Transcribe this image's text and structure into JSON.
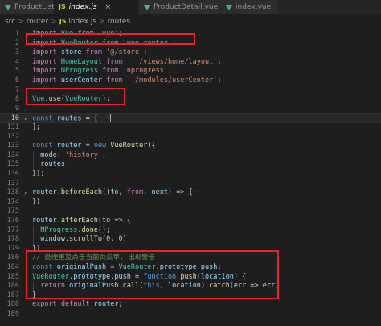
{
  "tabs": [
    {
      "label": "ProductList.vue",
      "icon": "vue-icon",
      "active": false
    },
    {
      "label": "index.js",
      "icon": "js-icon",
      "active": true,
      "close": "×"
    },
    {
      "label": "ProductDetail.vue",
      "icon": "vue-icon",
      "active": false
    },
    {
      "label": "index.vue",
      "icon": "vue-icon",
      "active": false
    }
  ],
  "js_icon_text": "JS",
  "breadcrumb": {
    "parts": [
      "src",
      "router",
      "index.js",
      "routes"
    ],
    "separator": ">",
    "file_icon_text": "JS"
  },
  "lines": [
    {
      "no": "1",
      "text": "import Vue from 'vue';"
    },
    {
      "no": "2",
      "text": "import VueRouter from 'vue-router';"
    },
    {
      "no": "3",
      "text": "import store from '@/store';"
    },
    {
      "no": "4",
      "text": "import HomeLayout from '../views/home/layout';"
    },
    {
      "no": "5",
      "text": "import NProgress from 'nprogress';"
    },
    {
      "no": "6",
      "text": "import userCenter from './modules/userCenter';"
    },
    {
      "no": "7",
      "text": ""
    },
    {
      "no": "8",
      "text": "Vue.use(VueRouter);"
    },
    {
      "no": "9",
      "text": ""
    },
    {
      "no": "10",
      "text": "const routes = [···"
    },
    {
      "no": "131",
      "text": "];"
    },
    {
      "no": "132",
      "text": ""
    },
    {
      "no": "133",
      "text": "const router = new VueRouter({"
    },
    {
      "no": "134",
      "text": "  mode: 'history',"
    },
    {
      "no": "135",
      "text": "  routes"
    },
    {
      "no": "136",
      "text": "});"
    },
    {
      "no": "137",
      "text": ""
    },
    {
      "no": "138",
      "text": "router.beforeEach((to, from, next) => {···"
    },
    {
      "no": "174",
      "text": "})"
    },
    {
      "no": "175",
      "text": ""
    },
    {
      "no": "176",
      "text": "router.afterEach(to => {"
    },
    {
      "no": "177",
      "text": "  NProgress.done();"
    },
    {
      "no": "178",
      "text": "  window.scrollTo(0, 0)"
    },
    {
      "no": "179",
      "text": "})"
    },
    {
      "no": "180",
      "text": "// 处理重复点击当前页菜单, 出现警告"
    },
    {
      "no": "184",
      "text": "const originalPush = VueRouter.prototype.push;"
    },
    {
      "no": "185",
      "text": "VueRouter.prototype.push = function push(location) {"
    },
    {
      "no": "186",
      "text": "  return originalPush.call(this, location).catch(err => err)"
    },
    {
      "no": "187",
      "text": "}"
    },
    {
      "no": "188",
      "text": "export default router;"
    },
    {
      "no": "189",
      "text": ""
    }
  ],
  "colors": {
    "background": "#1e1e1e",
    "keyword_import": "#c586c0",
    "keyword": "#569cd6",
    "string": "#ce9178",
    "variable": "#9cdcfe",
    "function": "#dcdcaa",
    "comment": "#6a9955",
    "highlight_box": "#e4262c"
  }
}
